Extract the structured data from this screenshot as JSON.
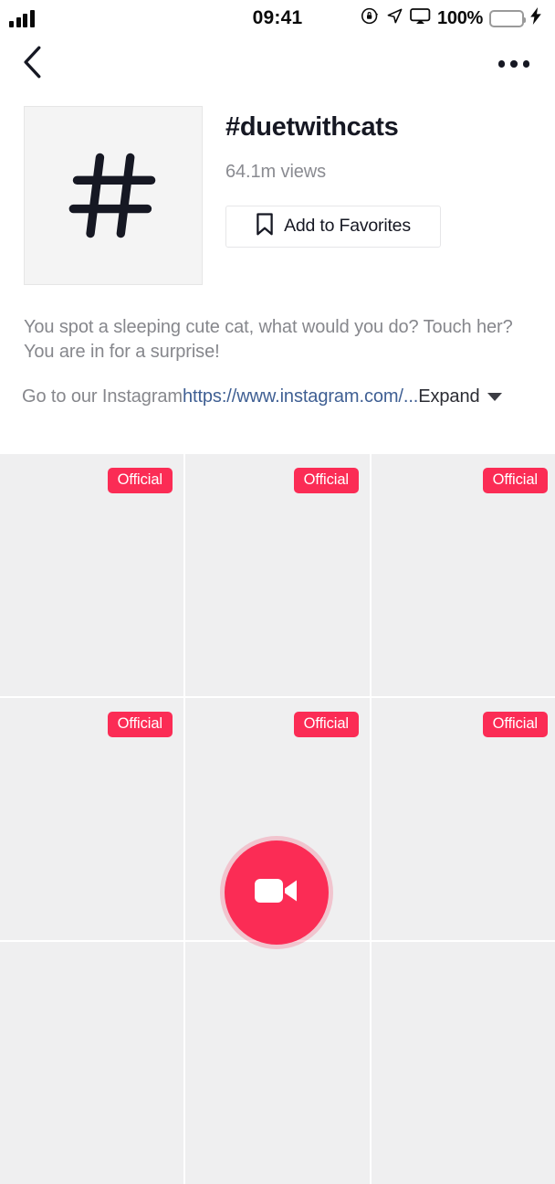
{
  "status_bar": {
    "signal_icon": "signal-bars-icon",
    "time": "09:41",
    "rotation_lock_icon": "rotation-lock-icon",
    "location_icon": "location-arrow-icon",
    "airplay_icon": "airplay-screen-icon",
    "battery_percent": "100%",
    "battery_icon": "battery-full-icon",
    "charging_icon": "lightning-bolt-icon",
    "battery_color": "#3ddc5b"
  },
  "nav": {
    "back_icon": "chevron-left-icon",
    "more_icon": "more-horizontal-icon"
  },
  "hashtag": {
    "avatar_icon": "hashtag-icon",
    "title": "#duetwithcats",
    "views": "64.1m views",
    "favorite_button": {
      "label": "Add to Favorites",
      "icon": "bookmark-icon"
    }
  },
  "description": {
    "text": "You spot a sleeping cute cat, what would you do? Touch her? You are in for a surprise!",
    "link_prefix": "Go to our Instagram ",
    "link_text": "https://www.instagram.com/...",
    "expand_label": "Expand",
    "expand_icon": "chevron-down-icon",
    "link_color": "#3f5f93"
  },
  "grid": {
    "badge_color": "#fb2c55",
    "items": [
      {
        "badge": "Official"
      },
      {
        "badge": "Official"
      },
      {
        "badge": "Official"
      },
      {
        "badge": "Official"
      },
      {
        "badge": "Official"
      },
      {
        "badge": "Official"
      },
      {
        "badge": ""
      },
      {
        "badge": ""
      },
      {
        "badge": ""
      }
    ]
  },
  "record_button": {
    "icon": "video-camera-icon",
    "color": "#fb2c55"
  }
}
